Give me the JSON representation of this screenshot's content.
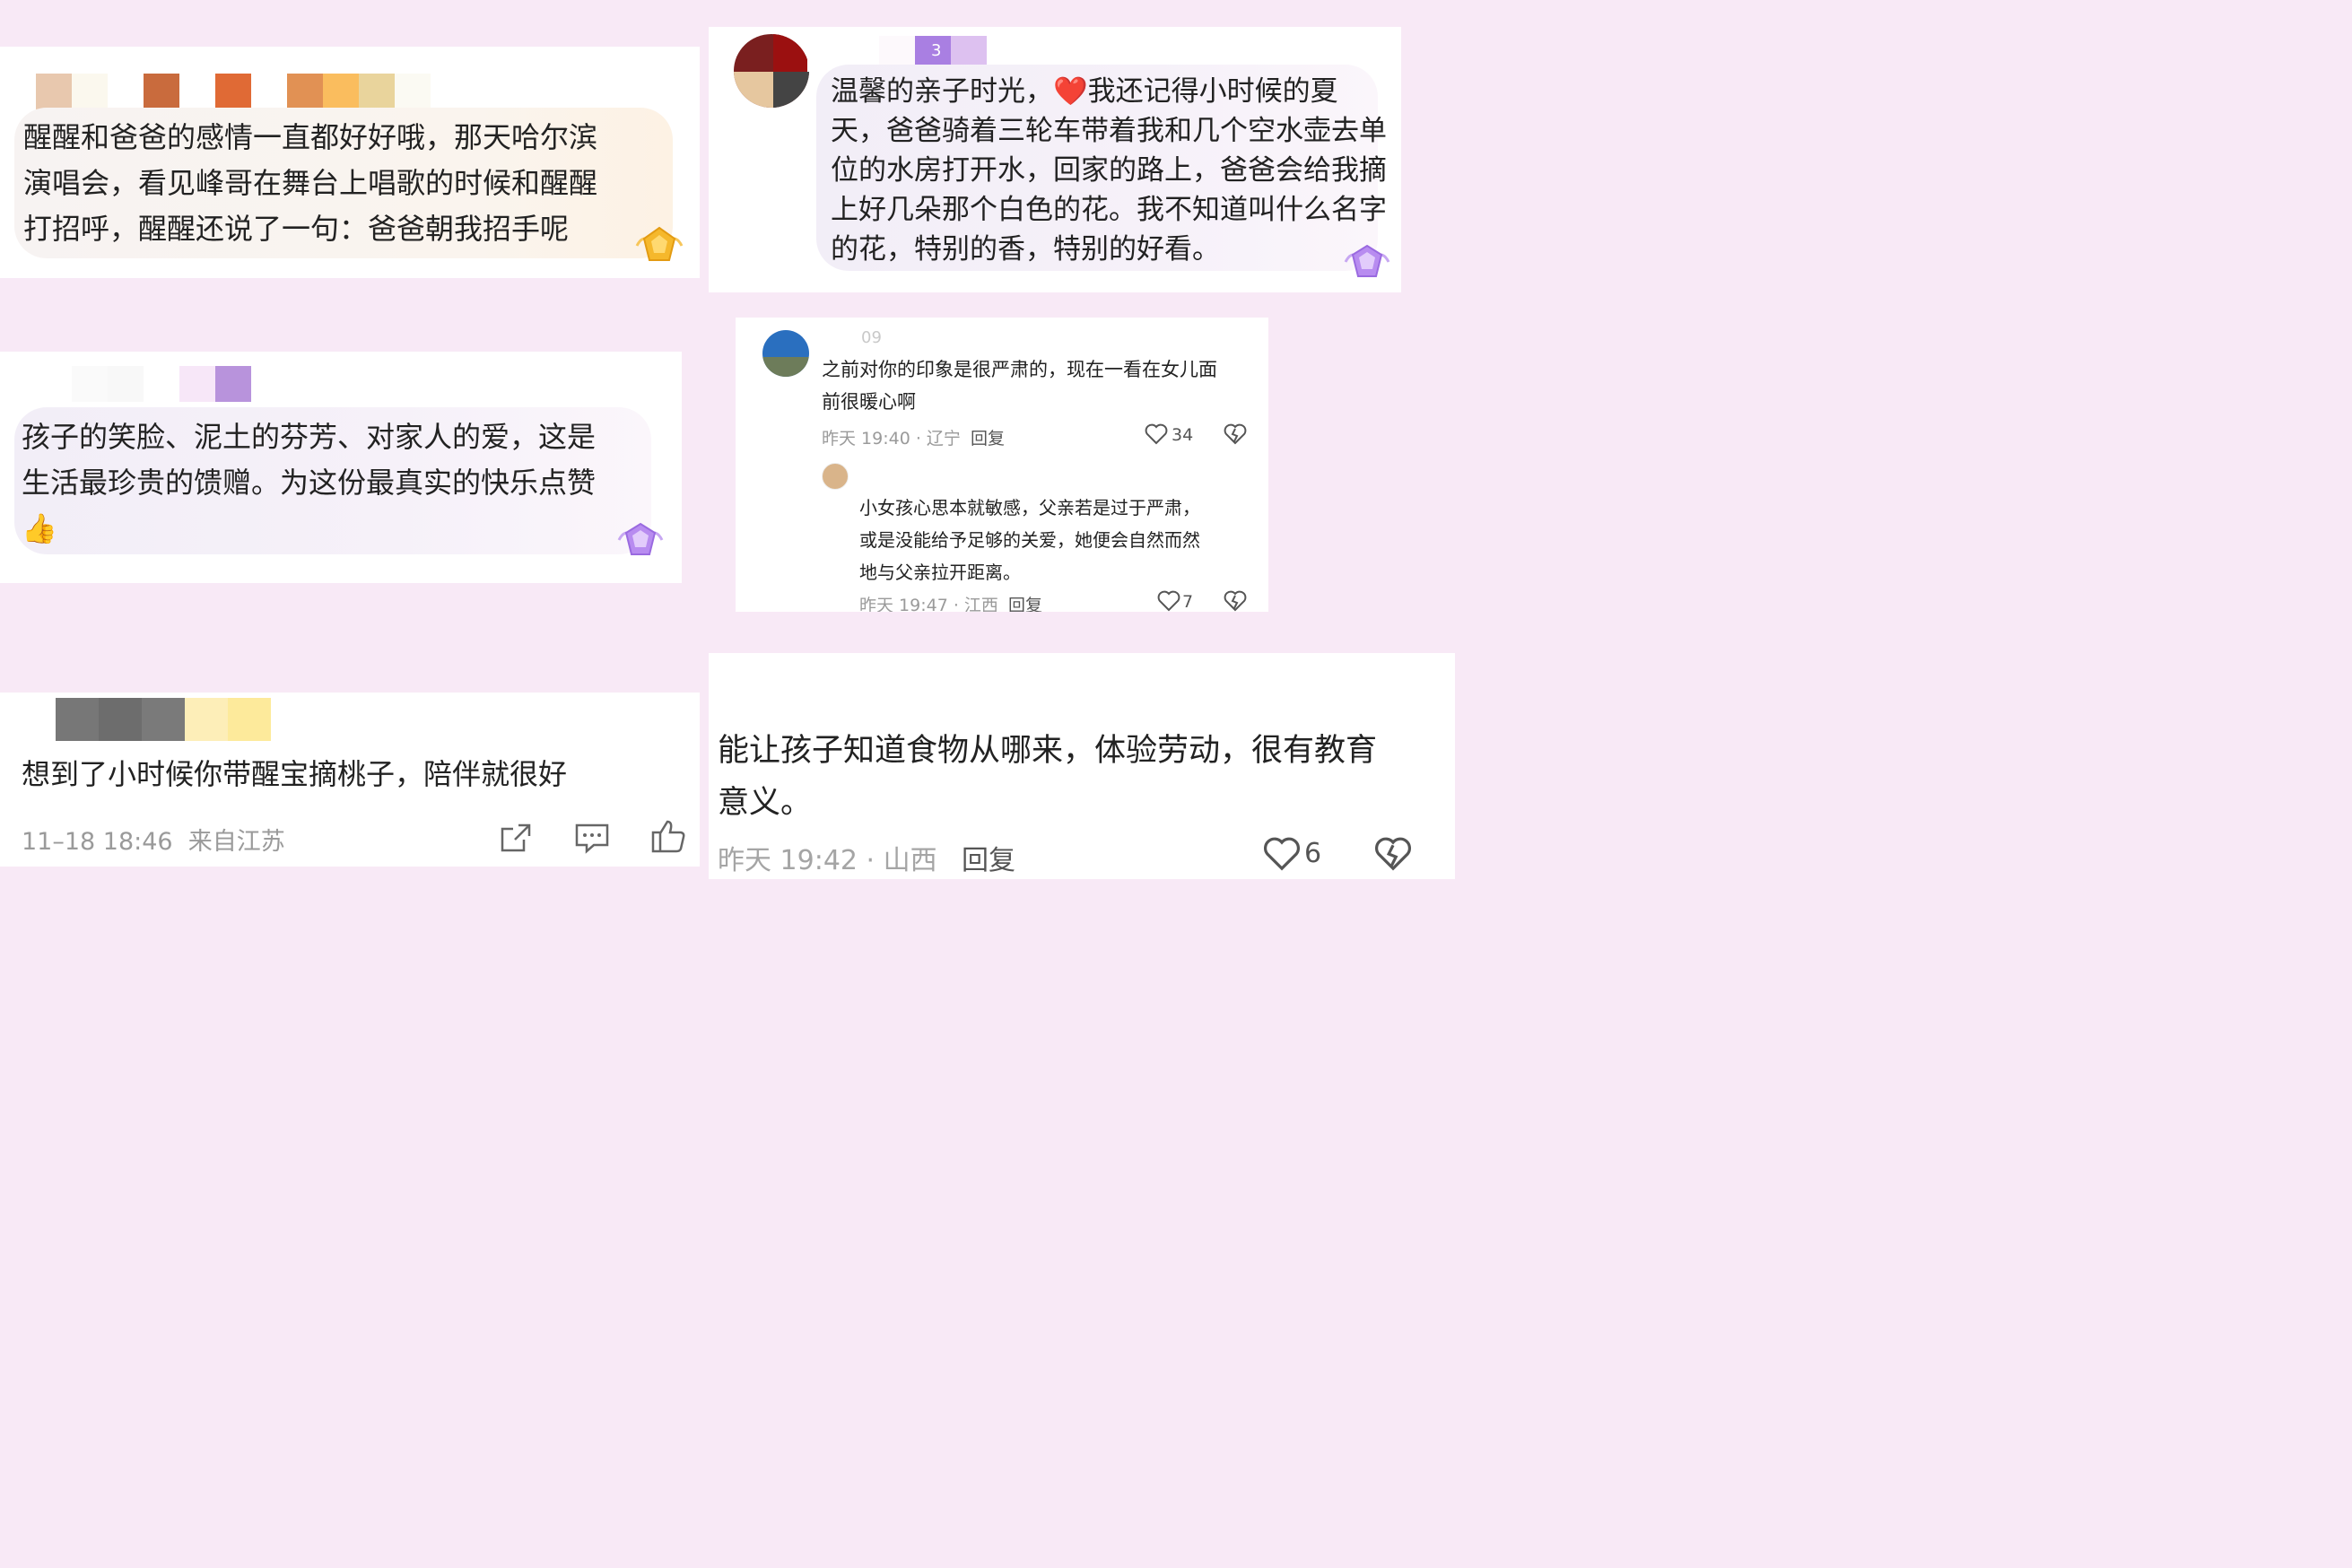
{
  "comments": [
    {
      "text": "醒醒和爸爸的感情一直都好好哦，那天哈尔滨\n演唱会，看见峰哥在舞台上唱歌的时候和醒醒\n打招呼，醒醒还说了一句：爸爸朝我招手呢",
      "mosaic_colors": [
        "#e8c8ae",
        "#fbf8ee",
        "#ffffff",
        "#c96b3d",
        "#ffffff",
        "#e06a35",
        "#ffffff",
        "#e19154",
        "#fabd5e",
        "#e9d49c",
        "#fbfaf3"
      ],
      "badge": "gold-gem-icon"
    },
    {
      "text": "温馨的亲子时光，❤️我还记得小时候的夏\n天，爸爸骑着三轮车带着我和几个空水壶去单\n位的水房打开水，回家的路上，爸爸会给我摘\n上好几朵那个白色的花。我不知道叫什么名字\n的花，特别的香，特别的好看。",
      "name_fragment": "3",
      "mosaic_colors": [
        "#ffffff",
        "#ffffff",
        "#fdf9fc",
        "#a97fe2",
        "#ddc1f0"
      ],
      "badge": "purple-gem-icon"
    },
    {
      "text": "孩子的笑脸、泥土的芬芳、对家人的爱，这是\n生活最珍贵的馈赠。为这份最真实的快乐点赞\n👍",
      "mosaic_colors": [
        "#ffffff",
        "#fafafa",
        "#f8f8f8",
        "#ffffff",
        "#f7e7f8",
        "#b893dc"
      ],
      "badge": "purple-gem-icon"
    },
    {
      "name_fragment": "09",
      "text": "之前对你的印象是很严肃的，现在一看在女儿面\n前很暖心啊",
      "time": "昨天 19:40 · 辽宁",
      "reply_label": "回复",
      "likes": "34",
      "reply": {
        "text": "小女孩心思本就敏感，父亲若是过于严肃，\n或是没能给予足够的关爱，她便会自然而然\n地与父亲拉开距离。",
        "time": "昨天 19:47 · 江西",
        "reply_label": "回复",
        "likes": "7"
      }
    },
    {
      "text": "想到了小时候你带醒宝摘桃子，陪伴就很好",
      "time": "11–18 18:46  来自江苏",
      "mosaic_colors": [
        "#ffffff",
        "#777777",
        "#6d6d6d",
        "#7a7a7a",
        "#fdeeb8",
        "#fdea9b"
      ]
    },
    {
      "text": "能让孩子知道食物从哪来，体验劳动，很有教育\n意义。",
      "time": "昨天 19:42 · 山西",
      "reply_label": "回复",
      "likes": "6"
    }
  ],
  "colors": {
    "background": "#f8e9f6",
    "text": "#222222",
    "meta": "#9a9a9a"
  }
}
